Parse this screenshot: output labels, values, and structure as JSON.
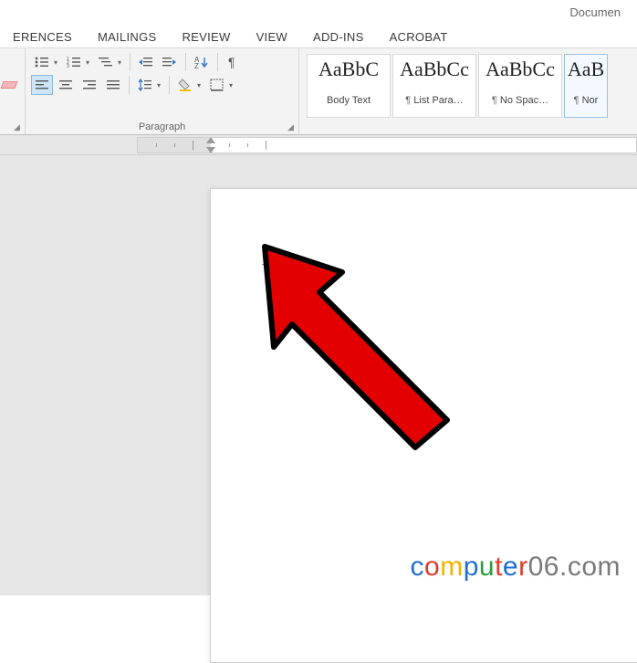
{
  "title": "Documen",
  "tabs": [
    "ERENCES",
    "MAILINGS",
    "REVIEW",
    "VIEW",
    "ADD-INS",
    "ACROBAT"
  ],
  "paragraph": {
    "group_label": "Paragraph"
  },
  "styles_gallery": [
    {
      "sample": "AaBbC",
      "name": "Body Text",
      "pilcrow": false
    },
    {
      "sample": "AaBbCc",
      "name": "List Para…",
      "pilcrow": true
    },
    {
      "sample": "AaBbCc",
      "name": "No Spac…",
      "pilcrow": true
    },
    {
      "sample": "AaB",
      "name": "Nor",
      "pilcrow": true
    }
  ],
  "document": {
    "inserted_symbol": "√"
  },
  "watermark": {
    "letters": [
      "c",
      "o",
      "m",
      "p",
      "u",
      "t",
      "e",
      "r"
    ],
    "suffix": "06.com"
  }
}
